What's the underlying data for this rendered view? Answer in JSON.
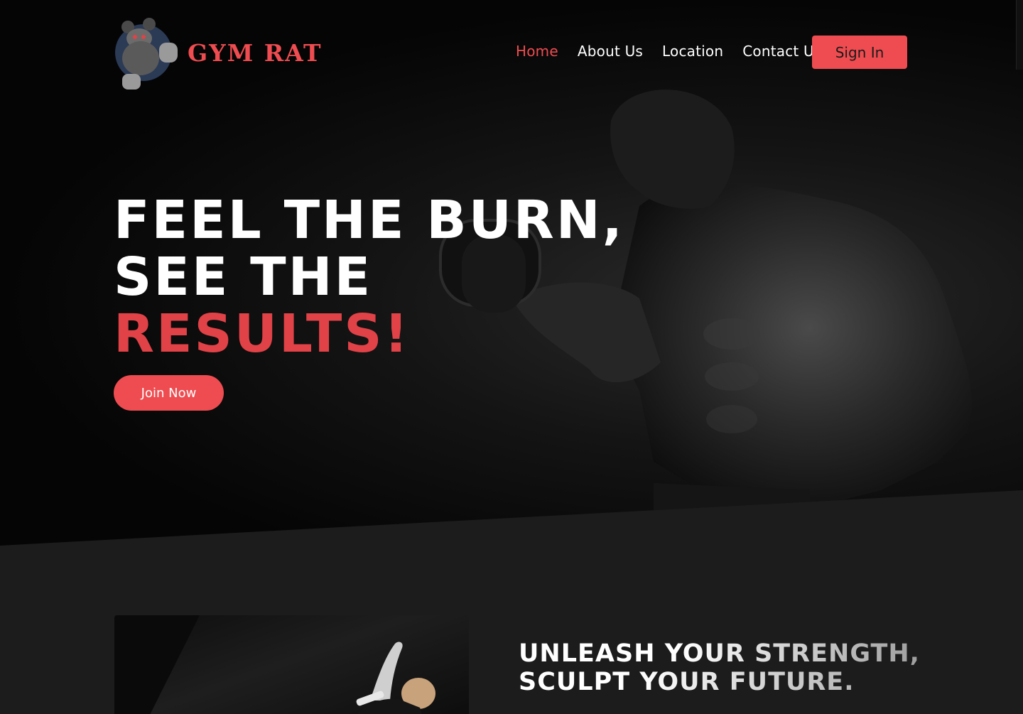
{
  "brand": {
    "name": "GYM RAT",
    "logo_icon": "rat-mascot-icon",
    "accent_color": "#ee4c50"
  },
  "nav": {
    "items": [
      {
        "label": "Home",
        "active": true
      },
      {
        "label": "About Us",
        "active": false
      },
      {
        "label": "Location",
        "active": false
      },
      {
        "label": "Contact Us",
        "active": false
      }
    ],
    "signin_label": "Sign In"
  },
  "hero": {
    "line1": "FEEL THE BURN,",
    "line2": "SEE THE",
    "line3": "RESULTS!",
    "cta_label": "Join Now"
  },
  "section2": {
    "tagline_line1": "UNLEASH YOUR STRENGTH,",
    "tagline_line2": "SCULPT YOUR FUTURE."
  }
}
